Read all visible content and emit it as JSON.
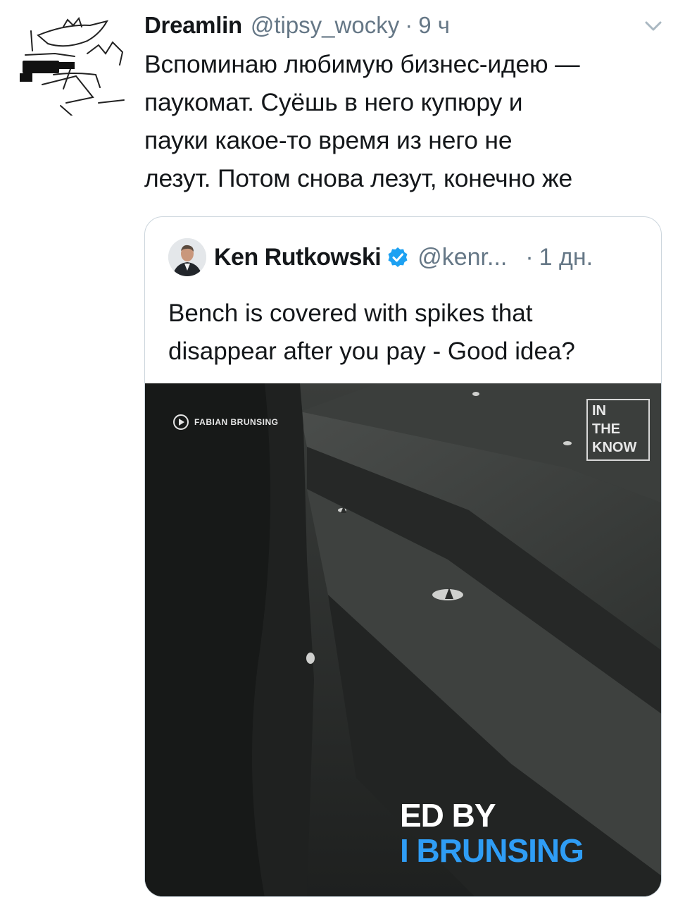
{
  "tweet": {
    "author_name": "Dreamlin",
    "author_handle": "@tipsy_wocky",
    "separator": "·",
    "time": "9 ч",
    "text_lines": [
      "Вспоминаю любимую бизнес-идею —",
      "паукомат. Суёшь в него купюру и",
      "пауки какое-то время из него не",
      "лезут. Потом снова лезут, конечно же"
    ]
  },
  "quoted_tweet": {
    "author_name": "Ken Rutkowski",
    "author_handle": "@kenr...",
    "separator": "·",
    "time": "1 дн.",
    "text_lines": [
      "Bench is covered with spikes that",
      "disappear after you pay - Good idea?"
    ],
    "media": {
      "credit": "FABIAN BRUNSING",
      "watermark_lines": [
        "IN",
        "THE",
        "KNOW"
      ],
      "caption_line1": "ED BY",
      "caption_line2": "I BRUNSING"
    }
  },
  "icons": {
    "menu": "chevron-down-icon",
    "verified": "verified-badge-icon",
    "play": "play-circle-icon"
  },
  "colors": {
    "text_primary": "#14171a",
    "text_secondary": "#657786",
    "border": "#ccd6dd",
    "verified_blue": "#1da1f2",
    "caption_blue": "#2f9df5"
  }
}
